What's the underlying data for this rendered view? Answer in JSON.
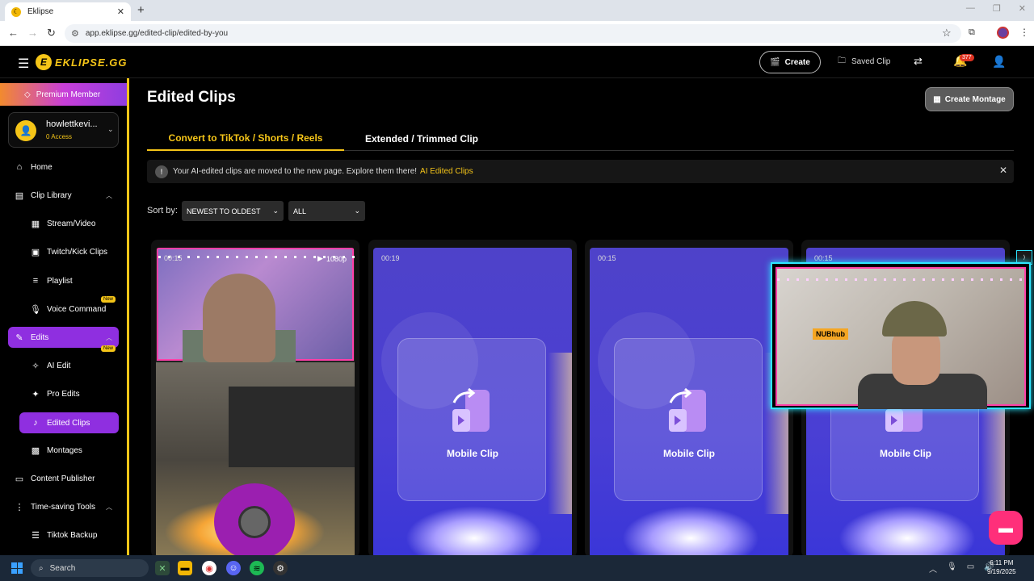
{
  "browser": {
    "tab_title": "Eklipse",
    "tab_close": "✕",
    "new_tab": "+",
    "url": "app.eklipse.gg/edited-clip/edited-by-you"
  },
  "header": {
    "logo_text": "EKLIPSE.GG",
    "create_label": "Create",
    "saved_clip_label": "Saved Clip",
    "notifications_count": "377"
  },
  "sidebar": {
    "premium_label": "Premium Member",
    "account": {
      "name": "howlettkevi...",
      "access": "0 Access"
    },
    "items": [
      {
        "label": "Home"
      },
      {
        "label": "Clip Library"
      },
      {
        "label": "Stream/Video"
      },
      {
        "label": "Twitch/Kick Clips"
      },
      {
        "label": "Playlist"
      },
      {
        "label": "Voice Command",
        "badge": "New"
      },
      {
        "label": "Edits"
      },
      {
        "label": "AI Edit",
        "badge": "New"
      },
      {
        "label": "Pro Edits"
      },
      {
        "label": "Edited Clips"
      },
      {
        "label": "Montages"
      },
      {
        "label": "Content Publisher"
      },
      {
        "label": "Time-saving Tools"
      },
      {
        "label": "Tiktok Backup"
      }
    ]
  },
  "main": {
    "title": "Edited Clips",
    "create_montage_label": "Create Montage",
    "tabs": [
      {
        "label": "Convert to TikTok / Shorts / Reels",
        "active": true
      },
      {
        "label": "Extended / Trimmed Clip",
        "active": false
      }
    ],
    "notice": {
      "text": "Your AI-edited clips are moved to the new page. Explore them there!",
      "link": "AI Edited Clips"
    },
    "sort": {
      "label": "Sort by:",
      "order_value": "NEWEST TO OLDEST",
      "filter_value": "ALL"
    },
    "cards": [
      {
        "duration": "00:15",
        "resolution": "1080p"
      },
      {
        "duration": "00:19",
        "label": "Mobile Clip"
      },
      {
        "duration": "00:15",
        "label": "Mobile Clip"
      },
      {
        "duration": "00:15",
        "label": "Mobile Clip"
      }
    ],
    "overlay_sign": "NUBhub"
  },
  "taskbar": {
    "search_label": "Search",
    "time": "6:11 PM",
    "date": "9/19/2025"
  },
  "colors": {
    "accent": "#f5c518",
    "active_purple": "#8f2fe0",
    "chat_pink": "#ff2f7a"
  }
}
